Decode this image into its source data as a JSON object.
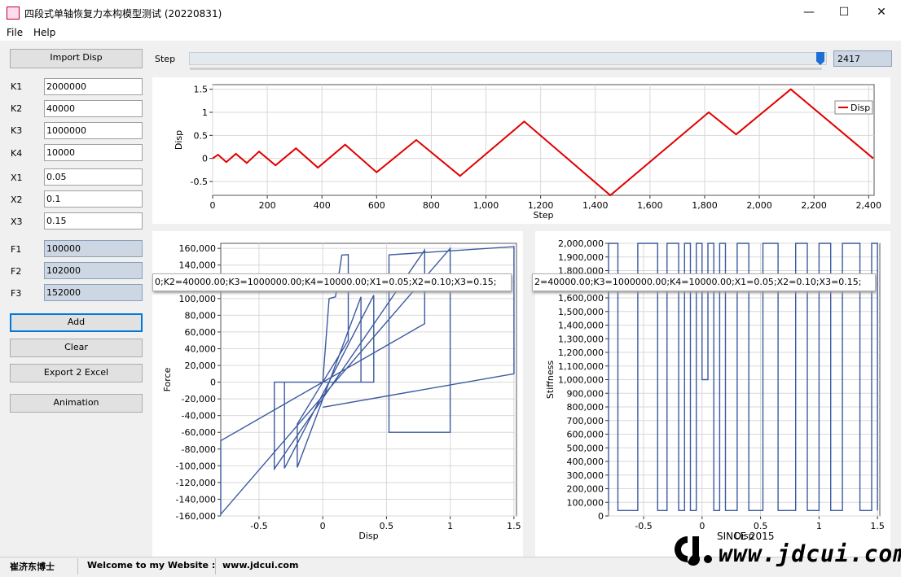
{
  "window": {
    "title": "四段式单轴恢复力本构模型测试 (20220831)",
    "minimize_glyph": "—",
    "maximize_glyph": "☐",
    "close_glyph": "✕"
  },
  "menu": {
    "file": "File",
    "help": "Help"
  },
  "panel": {
    "import_button": "Import Disp",
    "fields": [
      {
        "label": "K1",
        "value": "2000000"
      },
      {
        "label": "K2",
        "value": "40000"
      },
      {
        "label": "K3",
        "value": "1000000"
      },
      {
        "label": "K4",
        "value": "10000"
      },
      {
        "label": "X1",
        "value": "0.05"
      },
      {
        "label": "X2",
        "value": "0.1"
      },
      {
        "label": "X3",
        "value": "0.15"
      },
      {
        "label": "F1",
        "value": "100000"
      },
      {
        "label": "F2",
        "value": "102000"
      },
      {
        "label": "F3",
        "value": "152000"
      }
    ],
    "add_button": "Add",
    "clear_button": "Clear",
    "export_button": "Export 2 Excel",
    "animation_button": "Animation"
  },
  "step": {
    "label": "Step",
    "value": "2417",
    "max": 2417,
    "position": 2417
  },
  "series_tooltip_left": "0;K2=40000.00;K3=1000000.00;K4=10000.00;X1=0.05;X2=0.10;X3=0.15;",
  "series_tooltip_right": "2=40000.00;K3=1000000.00;K4=10000.00;X1=0.05;X2=0.10;X3=0.15;",
  "colors": {
    "disp_line": "#e00000",
    "hysteresis_line": "#3c5aa0",
    "selected_border": "#0078d7"
  },
  "chart_data": [
    {
      "type": "line",
      "title": "",
      "xlabel": "Step",
      "ylabel": "Disp",
      "xlim": [
        0,
        2420
      ],
      "ylim": [
        -0.8,
        1.6
      ],
      "xticks": [
        "0",
        "200",
        "400",
        "600",
        "800",
        "1,000",
        "1,200",
        "1,400",
        "1,600",
        "1,800",
        "2,000",
        "2,200",
        "2,400"
      ],
      "yticks": [
        "-0.5",
        "0",
        "0.5",
        "1",
        "1.5"
      ],
      "grid": true,
      "legend": "top-right",
      "series": [
        {
          "name": "Disp",
          "x": [
            0,
            20,
            50,
            85,
            125,
            170,
            230,
            305,
            385,
            485,
            600,
            745,
            905,
            1140,
            1455,
            1815,
            1915,
            2115,
            2417
          ],
          "y": [
            0,
            0.08,
            -0.08,
            0.1,
            -0.1,
            0.15,
            -0.15,
            0.22,
            -0.2,
            0.3,
            -0.3,
            0.4,
            -0.38,
            0.8,
            -0.8,
            1.0,
            0.52,
            1.5,
            0
          ]
        }
      ]
    },
    {
      "type": "line",
      "title": "",
      "xlabel": "Disp",
      "ylabel": "Force",
      "xlim": [
        -0.8,
        1.52
      ],
      "ylim": [
        -160000,
        166000
      ],
      "xticks": [
        "-0.5",
        "0",
        "0.5",
        "1",
        "1.5"
      ],
      "yticks": [
        "-160,000",
        "-140,000",
        "-120,000",
        "-100,000",
        "-80,000",
        "-60,000",
        "-40,000",
        "-20,000",
        "0",
        "20,000",
        "40,000",
        "60,000",
        "80,000",
        "100,000",
        "120,000",
        "140,000",
        "160,000"
      ],
      "grid": true,
      "series": [
        {
          "name": "",
          "x": [
            0,
            0.05,
            0.1,
            0.15,
            0.2,
            0.2,
            -0.2,
            -0.2,
            0.3,
            0.3,
            -0.3,
            -0.3,
            0.4,
            0.4,
            -0.38,
            -0.38,
            0.8,
            0.8,
            -0.8,
            -0.8,
            1.0,
            1.0,
            0.52,
            0.52,
            1.5,
            1.5,
            0
          ],
          "y": [
            0,
            100000,
            102000,
            152000,
            152500,
            50000,
            -50000,
            -102000,
            102000,
            0,
            0,
            -103000,
            104000,
            0,
            0,
            -103800,
            158000,
            70000,
            -70000,
            -158000,
            160000,
            -60000,
            -60000,
            152200,
            162000,
            10000,
            -30000
          ]
        }
      ]
    },
    {
      "type": "line",
      "title": "",
      "xlabel": "Disp",
      "ylabel": "Stiffness",
      "xlim": [
        -0.8,
        1.52
      ],
      "ylim": [
        0,
        2000000
      ],
      "xticks": [
        "-0.5",
        "0",
        "0.5",
        "1",
        "1.5"
      ],
      "yticks": [
        "0",
        "100,000",
        "200,000",
        "300,000",
        "400,000",
        "500,000",
        "600,000",
        "700,000",
        "800,000",
        "900,000",
        "1,000,000",
        "1,100,000",
        "1,200,000",
        "1,300,000",
        "1,400,000",
        "1,500,000",
        "1,600,000",
        "1,700,000",
        "1,800,000",
        "1,900,000",
        "2,000,000"
      ],
      "grid": true,
      "series": [
        {
          "name": "",
          "x": [
            -0.8,
            -0.8,
            -0.72,
            -0.72,
            -0.55,
            -0.55,
            -0.38,
            -0.38,
            -0.3,
            -0.3,
            -0.2,
            -0.2,
            -0.15,
            -0.15,
            -0.1,
            -0.1,
            -0.05,
            -0.05,
            0,
            0,
            0.05,
            0.05,
            0.1,
            0.1,
            0.15,
            0.15,
            0.2,
            0.2,
            0.3,
            0.3,
            0.4,
            0.4,
            0.52,
            0.52,
            0.65,
            0.65,
            0.8,
            0.8,
            0.9,
            0.9,
            1.0,
            1.0,
            1.1,
            1.1,
            1.2,
            1.2,
            1.35,
            1.35,
            1.45,
            1.45,
            1.5,
            1.5
          ],
          "y": [
            40000,
            2000000,
            2000000,
            40000,
            40000,
            2000000,
            2000000,
            40000,
            40000,
            2000000,
            2000000,
            40000,
            40000,
            2000000,
            2000000,
            40000,
            40000,
            2000000,
            2000000,
            1000000,
            1000000,
            2000000,
            2000000,
            40000,
            40000,
            2000000,
            2000000,
            40000,
            40000,
            2000000,
            2000000,
            40000,
            40000,
            2000000,
            2000000,
            40000,
            40000,
            2000000,
            2000000,
            40000,
            40000,
            2000000,
            2000000,
            40000,
            40000,
            2000000,
            2000000,
            40000,
            40000,
            2000000,
            2000000,
            40000
          ]
        }
      ]
    }
  ],
  "status": {
    "author": "崔济东博士",
    "welcome": "Welcome to my Website :",
    "site": "www.jdcui.com"
  },
  "watermark": {
    "since": "SINCE 2015",
    "text": "www.jdcui.com",
    "logo_letters": "CJ"
  }
}
